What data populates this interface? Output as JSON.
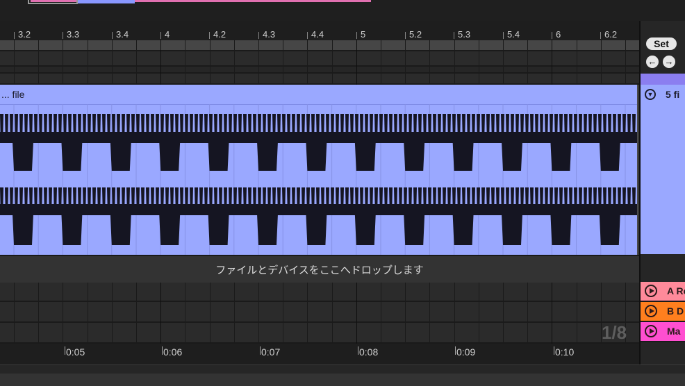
{
  "overview": {},
  "beat_ruler": {
    "ticks": [
      "3.2",
      "3.3",
      "3.4",
      "4",
      "4.2",
      "4.3",
      "4.4",
      "5",
      "5.2",
      "5.3",
      "5.4",
      "6",
      "6.2"
    ]
  },
  "clip": {
    "name": "... file",
    "color": "#9aa8ff"
  },
  "drop_zone": {
    "text": "ファイルとデバイスをここへドロップします"
  },
  "time_ruler": {
    "ticks": [
      "0:05",
      "0:06",
      "0:07",
      "0:08",
      "0:09",
      "0:10"
    ]
  },
  "grid_quantization": "1/8",
  "right_panel": {
    "set_label": "Set",
    "prev_label": "←",
    "next_label": "→",
    "track_title": "5 fi",
    "returns": [
      {
        "name": "A Re",
        "color": "#ff8a9a"
      },
      {
        "name": "B D",
        "color": "#ff7f1e"
      },
      {
        "name": "Ma",
        "color": "#ff4fd0"
      }
    ]
  }
}
